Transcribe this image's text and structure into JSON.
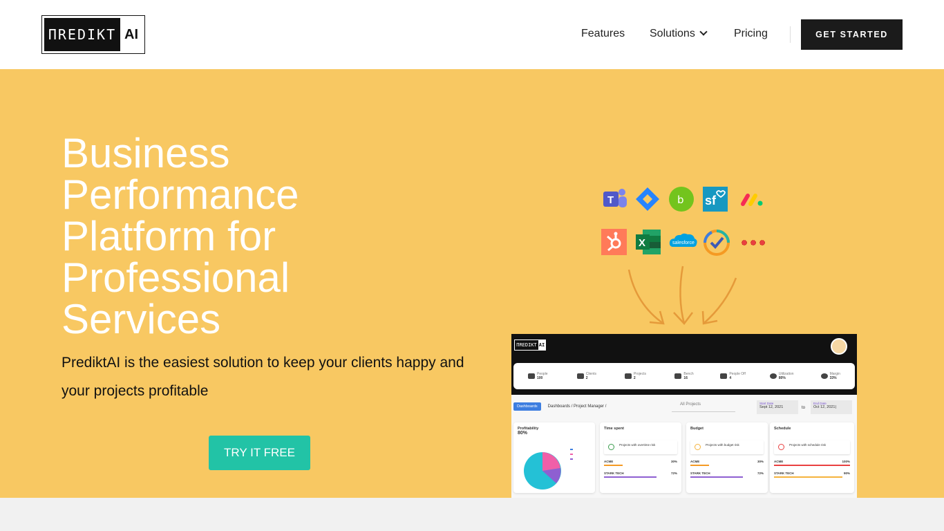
{
  "header": {
    "logo_main": "ΠREDIKT",
    "logo_ai": "AI",
    "nav": [
      {
        "label": "Features"
      },
      {
        "label": "Solutions"
      },
      {
        "label": "Pricing"
      }
    ],
    "cta_label": "GET STARTED"
  },
  "hero": {
    "title": "Business Performance Platform for Professional Services",
    "subtitle": "PrediktAI is the easiest solution to keep your clients happy and your projects profitable",
    "cta_label": "TRY IT FREE"
  },
  "integrations": {
    "icons": [
      "teams-icon",
      "jira-icon",
      "bamboohr-icon",
      "salesforce-sf-icon",
      "monday-icon",
      "hubspot-icon",
      "excel-icon",
      "salesforce-cloud-icon",
      "checkmark-app-icon",
      "more-dots-icon"
    ],
    "salesforce_text": "salesforce"
  },
  "dashboard": {
    "logo_main": "ΠREDIKT",
    "logo_ai": "AI",
    "kpis": [
      {
        "label": "People",
        "value": "100"
      },
      {
        "label": "Clients",
        "value": "2"
      },
      {
        "label": "Projects",
        "value": "2"
      },
      {
        "label": "Bench",
        "value": "16"
      },
      {
        "label": "People Off",
        "value": "4"
      },
      {
        "label": "Utilization",
        "value": "80%"
      },
      {
        "label": "Margin",
        "value": "33%"
      }
    ],
    "crumb_button": "Dashboards",
    "crumbs": "Dashboards / Project Manager /",
    "dropdown": "All Projects",
    "start_label": "Start Date",
    "start_value": "Sept 12, 2021",
    "to": "to",
    "end_label": "End Date",
    "end_value": "Oct 12, 2021|",
    "cards": [
      {
        "title": "Profitability",
        "value": "80%"
      },
      {
        "title": "Time spent",
        "risk": "Projects with overtime risk",
        "rows": [
          {
            "name": "ACME",
            "pct": "30%"
          },
          {
            "name": "STARK TECH",
            "pct": "72%"
          }
        ]
      },
      {
        "title": "Budget",
        "risk": "Projects with budget risk",
        "rows": [
          {
            "name": "ACME",
            "pct": "30%"
          },
          {
            "name": "STARK TECH",
            "pct": "72%"
          }
        ]
      },
      {
        "title": "Schedule",
        "risk": "Projects with schedule risk",
        "rows": [
          {
            "name": "ACME",
            "pct": "100%"
          },
          {
            "name": "STARK TECH",
            "pct": "90%"
          }
        ]
      }
    ]
  },
  "colors": {
    "hero_bg": "#f8c862",
    "cta_dark": "#1b1b1b",
    "cta_teal": "#22c3a6"
  }
}
